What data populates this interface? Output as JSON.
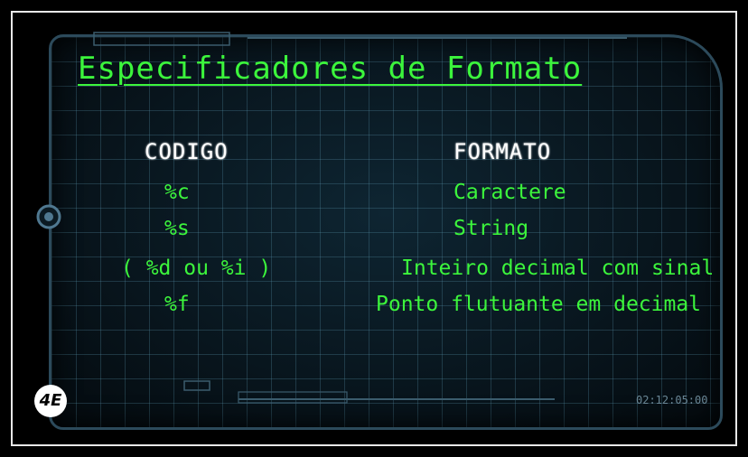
{
  "slide": {
    "title": "Especificadores de Formato",
    "headers": {
      "code": "CODIGO",
      "format": "FORMATO"
    },
    "rows": [
      {
        "code": "%c",
        "format": "Caractere"
      },
      {
        "code": "%s",
        "format": "String"
      },
      {
        "code": "( %d ou %i )",
        "format": "Inteiro decimal com sinal"
      },
      {
        "code": "%f",
        "format": "Ponto flutuante em decimal"
      }
    ],
    "clock": "02:12:05:00",
    "logo_text": "4E",
    "colors": {
      "text_green": "#3cf53c",
      "header_white": "#ffffff",
      "background": "#07141c",
      "frame": "#e8e8e8"
    }
  }
}
